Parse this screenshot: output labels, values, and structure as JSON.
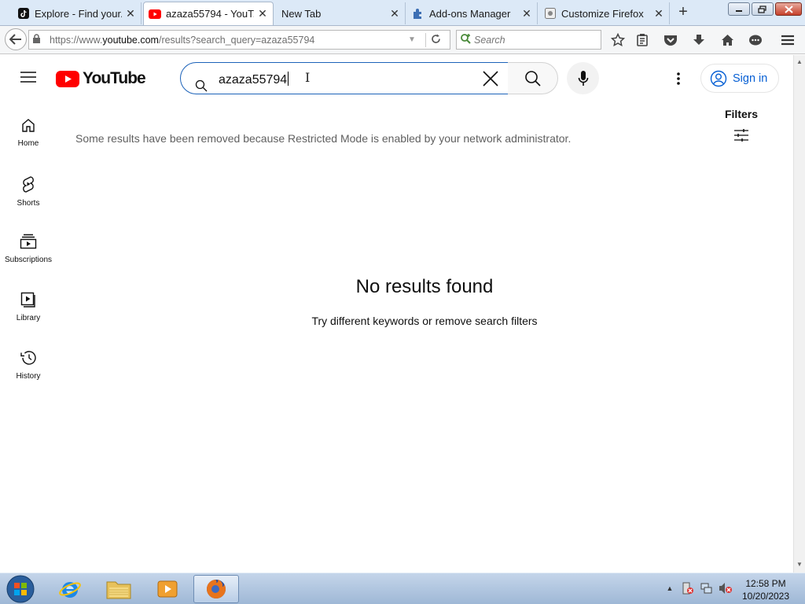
{
  "browser": {
    "tabs": [
      {
        "label": "Explore - Find your...",
        "icon": "tiktok-icon",
        "active": false
      },
      {
        "label": "azaza55794 - YouT...",
        "icon": "youtube-icon",
        "active": true
      },
      {
        "label": "New Tab",
        "icon": "",
        "active": false
      },
      {
        "label": "Add-ons Manager",
        "icon": "puzzle-icon",
        "active": false
      },
      {
        "label": "Customize Firefox",
        "icon": "customize-icon",
        "active": false
      }
    ],
    "new_tab_glyph": "+",
    "url_prefix": "https://www.",
    "url_domain": "youtube.com",
    "url_path": "/results?search_query=azaza55794",
    "search_placeholder": "Search"
  },
  "youtube": {
    "logo_text": "YouTube",
    "search_value": "azaza55794",
    "sign_in_label": "Sign in",
    "sidebar": [
      {
        "label": "Home",
        "icon": "home-icon"
      },
      {
        "label": "Shorts",
        "icon": "shorts-icon"
      },
      {
        "label": "Subscriptions",
        "icon": "subscriptions-icon"
      },
      {
        "label": "Library",
        "icon": "library-icon"
      },
      {
        "label": "History",
        "icon": "history-icon"
      }
    ],
    "restricted_notice": "Some results have been removed because Restricted Mode is enabled by your network administrator.",
    "filters_label": "Filters",
    "no_results_title": "No results found",
    "no_results_hint": "Try different keywords or remove search filters"
  },
  "taskbar": {
    "time": "12:58 PM",
    "date": "10/20/2023"
  },
  "colors": {
    "youtube_red": "#ff0000",
    "link_blue": "#065fd4",
    "search_focus": "#1c62b9"
  }
}
